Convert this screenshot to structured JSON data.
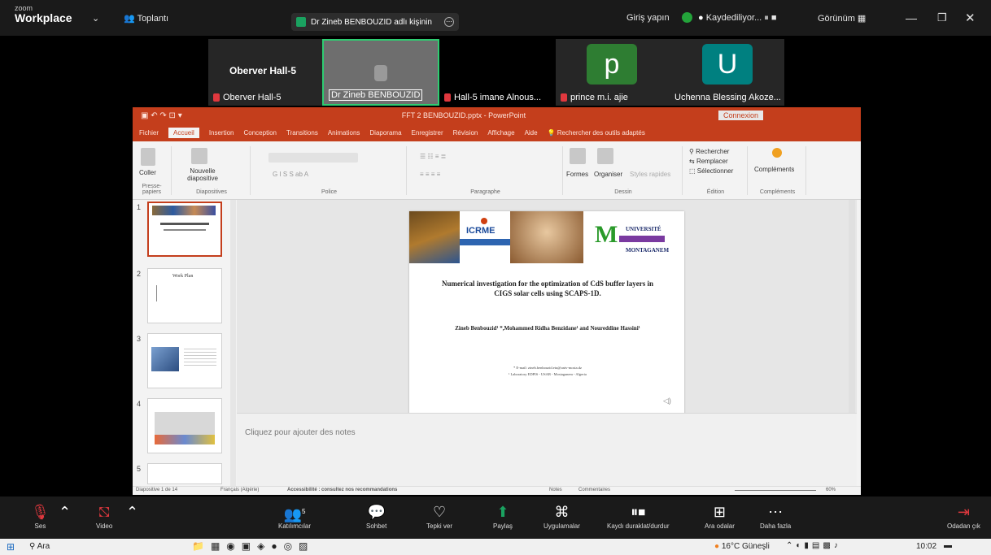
{
  "zoom": {
    "logo_small": "zoom",
    "logo_big": "Workplace",
    "meeting_label": "Toplantı",
    "share_banner": "Dr Zineb BENBOUZID adlı kişinin",
    "signin": "Giriş yapın",
    "recording": "Kaydediliyor...",
    "view": "Görünüm"
  },
  "gallery": [
    {
      "title": "Oberver Hall-5",
      "name": "Oberver Hall-5"
    },
    {
      "title": "",
      "name": "Dr Zineb BENBOUZID"
    },
    {
      "title": "",
      "name": "Hall-5 imane Alnous..."
    },
    {
      "title": "p",
      "name": "prince m.i. ajie",
      "color": "#2e7d32"
    },
    {
      "title": "U",
      "name": "Uchenna Blessing Akoze...",
      "color": "#008080"
    }
  ],
  "ppt": {
    "file_title": "FFT 2 BENBOUZID.pptx - PowerPoint",
    "connect": "Connexion",
    "menu": [
      "Fichier",
      "Accueil",
      "Insertion",
      "Conception",
      "Transitions",
      "Animations",
      "Diaporama",
      "Enregistrer",
      "Révision",
      "Affichage",
      "Aide"
    ],
    "search": "Rechercher des outils adaptés",
    "ribbon": {
      "paste": "Coller",
      "clipboard": "Presse-papiers",
      "new_slide": "Nouvelle diapositive",
      "slides": "Diapositives",
      "font": "Police",
      "paragraph": "Paragraphe",
      "shapes": "Formes",
      "arrange": "Organiser",
      "styles": "Styles rapides",
      "drawing": "Dessin",
      "find": "Rechercher",
      "replace": "Remplacer",
      "select": "Sélectionner",
      "editing": "Édition",
      "addins": "Compléments",
      "addins_group": "Compléments"
    },
    "thumb_nums": [
      "1",
      "2",
      "3",
      "4",
      "5"
    ],
    "thumb2_title": "Work Plan",
    "slide": {
      "conf": "ICRME",
      "univ": "UNIVERSITÉ",
      "univ2": "MONTAGANEM",
      "title": "Numerical investigation for the optimization of CdS buffer layers in CIGS solar cells using SCAPS-1D.",
      "authors": "Zineb Benbouzid¹ *,Mohammed Ridha Benzidane¹ and Noureddine Hassini¹",
      "email": "* E-mail: zineb.benbouzid.etu@univ-mosta.dz",
      "lab": "¹ Laboratory EDPIS - USAB - Mostaganem - Algeria"
    },
    "notes_placeholder": "Cliquez pour ajouter des notes",
    "status": {
      "slide_count": "Diapositive 1 de 14",
      "language": "Français (Algérie)",
      "accessibility": "Accessibilité : consultez nos recommandations",
      "notes": "Notes",
      "comments": "Commentaires",
      "zoom": "60%"
    }
  },
  "toolbar": {
    "mute": "Ses",
    "video": "Video",
    "participants": "Katılımcılar",
    "participants_count": "5",
    "chat": "Sohbet",
    "react": "Tepki ver",
    "share": "Paylaş",
    "apps": "Uygulamalar",
    "record": "Kaydı duraklat/durdur",
    "breakout": "Ara odalar",
    "more": "Daha fazla",
    "leave": "Odadan çık"
  },
  "taskbar": {
    "search": "Ara",
    "weather": "16°C Güneşli",
    "time": "10:02"
  }
}
